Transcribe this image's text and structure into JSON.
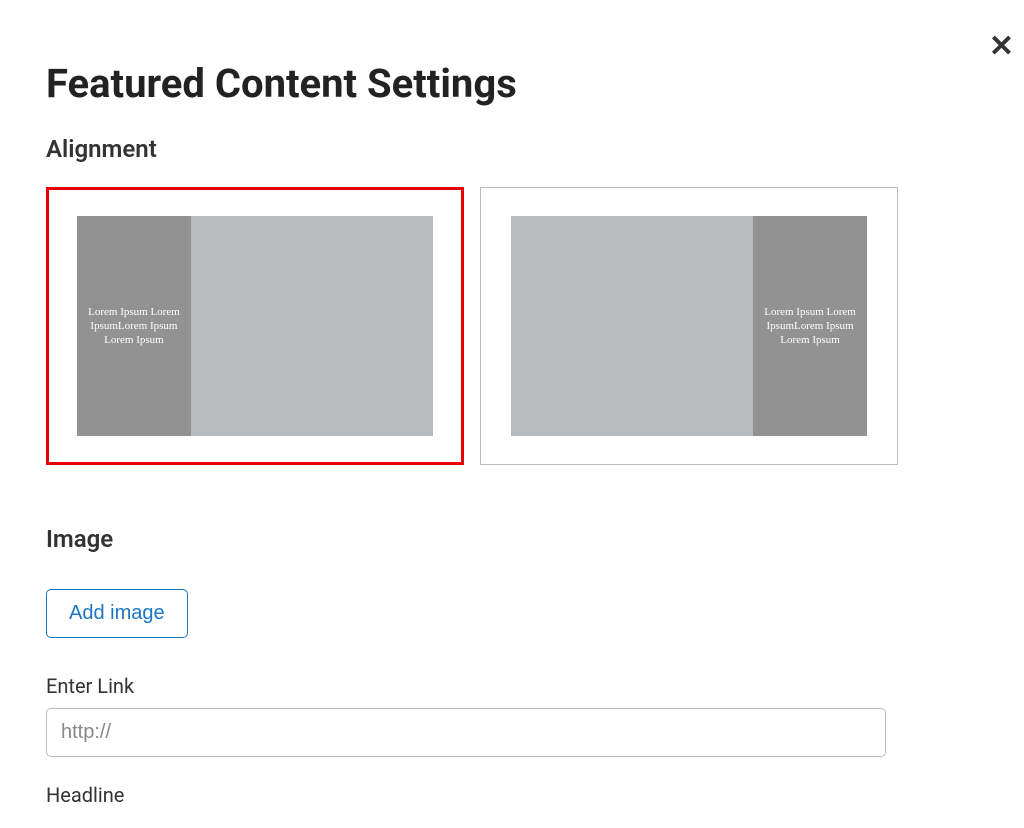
{
  "close_icon_glyph": "✕",
  "page_title": "Featured Content Settings",
  "alignment": {
    "heading": "Alignment",
    "options": [
      {
        "side": "left",
        "selected": true,
        "placeholder_text": "Lorem Ipsum Lorem IpsumLorem Ipsum Lorem Ipsum"
      },
      {
        "side": "right",
        "selected": false,
        "placeholder_text": "Lorem Ipsum Lorem IpsumLorem Ipsum Lorem Ipsum"
      }
    ]
  },
  "image": {
    "heading": "Image",
    "add_button_label": "Add image"
  },
  "link": {
    "label": "Enter Link",
    "placeholder": "http://",
    "value": ""
  },
  "headline": {
    "label": "Headline"
  }
}
